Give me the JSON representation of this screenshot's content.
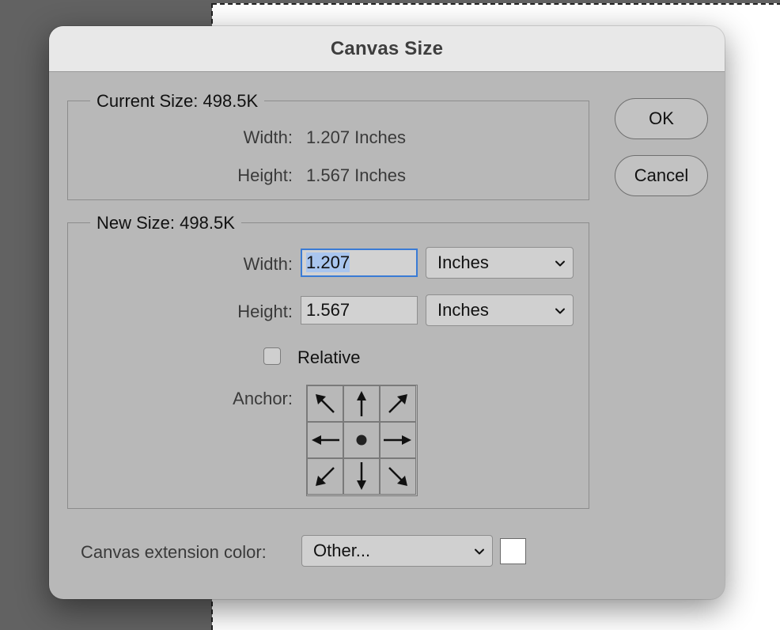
{
  "dialog": {
    "title": "Canvas Size"
  },
  "current_size": {
    "legend": "Current Size: 498.5K",
    "width_label": "Width:",
    "width_value": "1.207 Inches",
    "height_label": "Height:",
    "height_value": "1.567 Inches"
  },
  "new_size": {
    "legend": "New Size: 498.5K",
    "width_label": "Width:",
    "width_value": "1.207",
    "width_unit": "Inches",
    "height_label": "Height:",
    "height_value": "1.567",
    "height_unit": "Inches",
    "relative_label": "Relative",
    "relative_checked": false,
    "anchor_label": "Anchor:",
    "anchor_selected": "center"
  },
  "extension": {
    "label": "Canvas extension color:",
    "value": "Other...",
    "swatch_color": "#ffffff"
  },
  "buttons": {
    "ok": "OK",
    "cancel": "Cancel"
  },
  "icons": {
    "anchor_grid": [
      "arrow-up-left-icon",
      "arrow-up-icon",
      "arrow-up-right-icon",
      "arrow-left-icon",
      "center-dot-icon",
      "arrow-right-icon",
      "arrow-down-left-icon",
      "arrow-down-icon",
      "arrow-down-right-icon"
    ],
    "dropdown": "chevron-down-icon"
  }
}
